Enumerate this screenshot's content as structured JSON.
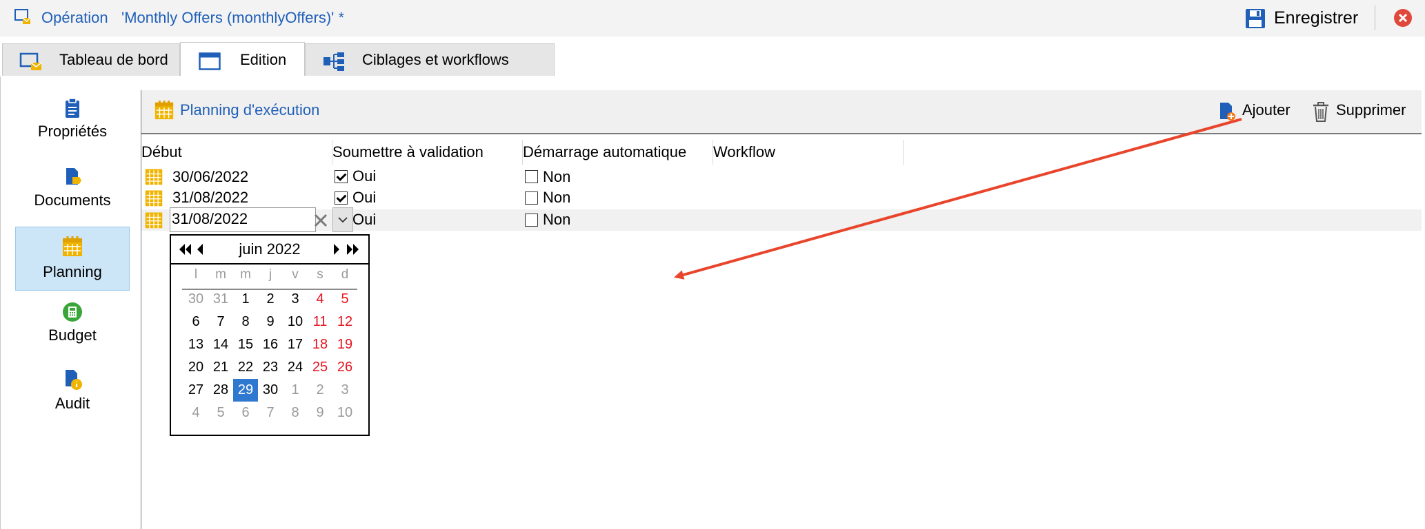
{
  "titlebar": {
    "operation_label": "Opération",
    "document_title": "'Monthly Offers (monthlyOffers)' *",
    "save_label": "Enregistrer"
  },
  "tabs": [
    {
      "label": "Tableau de bord",
      "icon": "dashboard-icon",
      "active": false
    },
    {
      "label": "Edition",
      "icon": "edit-window-icon",
      "active": true
    },
    {
      "label": "Ciblages et workflows",
      "icon": "workflow-icon",
      "active": false
    }
  ],
  "sidebar": {
    "items": [
      {
        "label": "Propriétés",
        "icon": "clipboard-icon",
        "selected": false
      },
      {
        "label": "Documents",
        "icon": "document-icon",
        "selected": false
      },
      {
        "label": "Planning",
        "icon": "calendar-icon",
        "selected": true
      },
      {
        "label": "Budget",
        "icon": "calculator-icon",
        "selected": false
      },
      {
        "label": "Audit",
        "icon": "audit-icon",
        "selected": false
      }
    ]
  },
  "panel": {
    "title": "Planning d'exécution",
    "add_label": "Ajouter",
    "delete_label": "Supprimer",
    "columns": [
      "Début",
      "Soumettre à validation",
      "Démarrage automatique",
      "Workflow"
    ],
    "rows": [
      {
        "start": "30/06/2022",
        "validation_checked": true,
        "validation_label": "Oui",
        "auto_checked": false,
        "auto_label": "Non",
        "workflow": ""
      },
      {
        "start": "31/08/2022",
        "validation_checked": true,
        "validation_label": "Oui",
        "auto_checked": false,
        "auto_label": "Non",
        "workflow": ""
      },
      {
        "start": "31/08/2022",
        "validation_checked": true,
        "validation_label": "Oui",
        "auto_checked": false,
        "auto_label": "Non",
        "workflow": "",
        "editing": true
      }
    ]
  },
  "datepicker": {
    "month_label": "juin 2022",
    "weekdays": [
      "l",
      "m",
      "m",
      "j",
      "v",
      "s",
      "d"
    ],
    "weeks": [
      [
        {
          "d": "30",
          "dim": true
        },
        {
          "d": "31",
          "dim": true
        },
        {
          "d": "1"
        },
        {
          "d": "2"
        },
        {
          "d": "3"
        },
        {
          "d": "4",
          "we": true
        },
        {
          "d": "5",
          "we": true
        }
      ],
      [
        {
          "d": "6"
        },
        {
          "d": "7"
        },
        {
          "d": "8"
        },
        {
          "d": "9"
        },
        {
          "d": "10"
        },
        {
          "d": "11",
          "we": true
        },
        {
          "d": "12",
          "we": true
        }
      ],
      [
        {
          "d": "13"
        },
        {
          "d": "14"
        },
        {
          "d": "15"
        },
        {
          "d": "16"
        },
        {
          "d": "17"
        },
        {
          "d": "18",
          "we": true
        },
        {
          "d": "19",
          "we": true
        }
      ],
      [
        {
          "d": "20"
        },
        {
          "d": "21"
        },
        {
          "d": "22"
        },
        {
          "d": "23"
        },
        {
          "d": "24"
        },
        {
          "d": "25",
          "we": true
        },
        {
          "d": "26",
          "we": true
        }
      ],
      [
        {
          "d": "27"
        },
        {
          "d": "28"
        },
        {
          "d": "29",
          "sel": true
        },
        {
          "d": "30"
        },
        {
          "d": "1",
          "dim": true
        },
        {
          "d": "2",
          "dim": true
        },
        {
          "d": "3",
          "dim": true
        }
      ],
      [
        {
          "d": "4",
          "dim": true
        },
        {
          "d": "5",
          "dim": true
        },
        {
          "d": "6",
          "dim": true
        },
        {
          "d": "7",
          "dim": true
        },
        {
          "d": "8",
          "dim": true
        },
        {
          "d": "9",
          "dim": true
        },
        {
          "d": "10",
          "dim": true
        }
      ]
    ]
  },
  "colors": {
    "accent_blue": "#1f5fb8",
    "selected_day": "#2f78d0",
    "weekend_red": "#e8121e",
    "annotation_arrow": "#e8452c",
    "calendar_yellow": "#f0b400",
    "nav_selected_bg": "#cde6f7"
  }
}
